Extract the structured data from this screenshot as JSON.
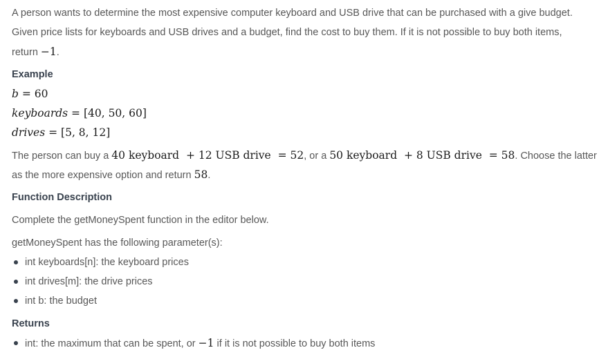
{
  "intro": {
    "line1": "A person wants to determine the most expensive computer keyboard and USB drive that can be purchased with a give budget.",
    "line2": "Given price lists for keyboards and USB drives and a budget, find the cost to buy them. If it is not possible to buy both items,",
    "line3_prefix": "return ",
    "line3_math": "−1",
    "line3_suffix": "."
  },
  "example": {
    "heading": "Example",
    "b_var": "b",
    "b_rest": " = 60",
    "keyboards_var": "keyboards",
    "keyboards_rest": " = [40, 50, 60]",
    "drives_var": "drives",
    "drives_rest": " = [5, 8, 12]",
    "explain_p1": "The person can buy a ",
    "explain_m1": "40 keyboard  + 12 USB drive  = 52",
    "explain_p2": ", or a ",
    "explain_m2": "50 keyboard  + 8 USB drive  = 58",
    "explain_p3": ". Choose the latter",
    "explain2_p1": "as the more expensive option and return ",
    "explain2_m1": "58",
    "explain2_p2": "."
  },
  "function_description": {
    "heading": "Function Description",
    "line1": "Complete the getMoneySpent function in the editor below.",
    "line2": "getMoneySpent has the following parameter(s):",
    "params": [
      "int keyboards[n]: the keyboard prices",
      "int drives[m]: the drive prices",
      "int b: the budget"
    ]
  },
  "returns": {
    "heading": "Returns",
    "item_p1": "int: the maximum that can be spent, or ",
    "item_math": "−1",
    "item_p2": " if it is not possible to buy both items"
  }
}
